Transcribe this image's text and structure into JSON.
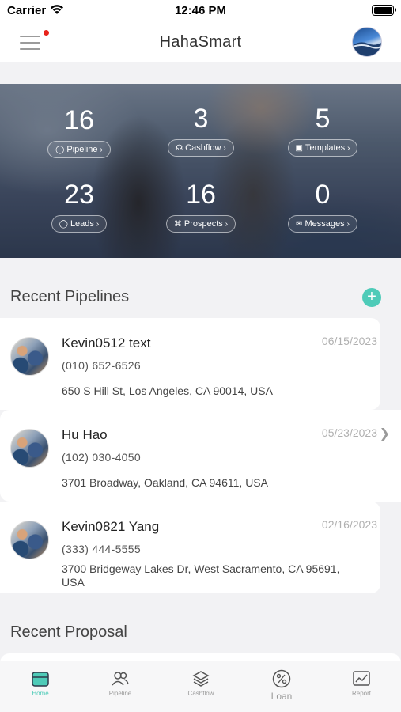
{
  "status_bar": {
    "carrier": "Carrier",
    "time": "12:46 PM"
  },
  "nav": {
    "title": "HahaSmart",
    "menu_icon": "hamburger-menu-icon",
    "notification_dot": true,
    "profile_icon": "avatar"
  },
  "stats": [
    {
      "value": "16",
      "label": "Pipeline",
      "icon": "user-icon"
    },
    {
      "value": "3",
      "label": "Cashflow",
      "icon": "cashflow-icon"
    },
    {
      "value": "5",
      "label": "Templates",
      "icon": "template-icon"
    },
    {
      "value": "23",
      "label": "Leads",
      "icon": "user-icon"
    },
    {
      "value": "16",
      "label": "Prospects",
      "icon": "prospects-icon"
    },
    {
      "value": "0",
      "label": "Messages",
      "icon": "mail-icon"
    }
  ],
  "recent_pipelines": {
    "title": "Recent Pipelines",
    "items": [
      {
        "name": "Kevin0512 text",
        "date": "06/15/2023",
        "phone": "(010) 652-6526",
        "address": "650 S Hill St, Los Angeles, CA 90014, USA"
      },
      {
        "name": "Hu Hao",
        "date": "05/23/2023",
        "phone": "(102) 030-4050",
        "address": "3701 Broadway, Oakland, CA 94611, USA"
      },
      {
        "name": "Kevin0821 Yang",
        "date": "02/16/2023",
        "phone": "(333) 444-5555",
        "address": "3700 Bridgeway Lakes Dr, West Sacramento, CA 95691, USA"
      }
    ]
  },
  "recent_proposal": {
    "title": "Recent Proposal"
  },
  "tabs": [
    {
      "label": "Home",
      "icon": "home-icon",
      "active": true
    },
    {
      "label": "Pipeline",
      "icon": "people-icon",
      "active": false
    },
    {
      "label": "Cashflow",
      "icon": "layers-icon",
      "active": false
    },
    {
      "label": "Loan",
      "icon": "percent-icon",
      "active": false
    },
    {
      "label": "Report",
      "icon": "chart-icon",
      "active": false
    }
  ],
  "colors": {
    "accent": "#4ecbb8",
    "notification": "#e8231b",
    "background": "#f2f2f4"
  }
}
